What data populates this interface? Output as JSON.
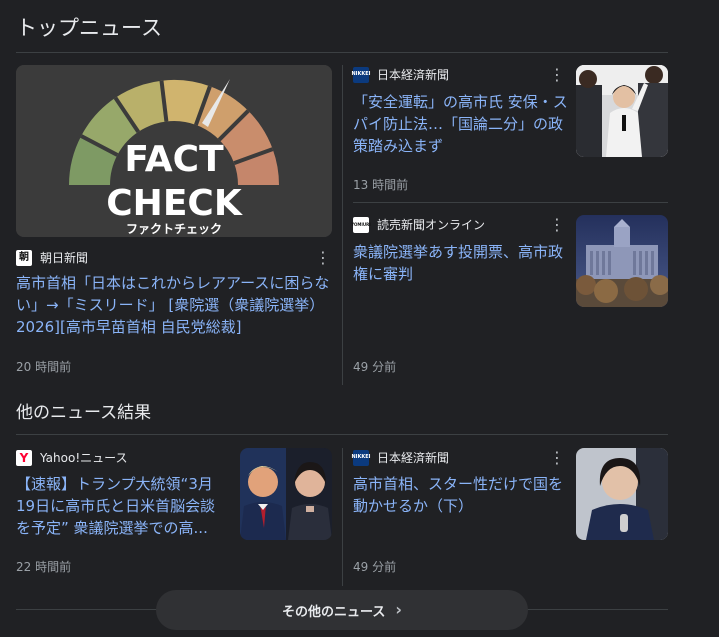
{
  "top_news": {
    "heading": "トップニュース",
    "featured": {
      "image_text_1": "FACT",
      "image_text_2": "CHECK",
      "image_text_3": "ファクトチェック",
      "source": "朝日新聞",
      "source_logo_text": "朝",
      "title": "高市首相「日本はこれからレアアースに困らない」→「ミスリード」 [衆院選（衆議院選挙）2026][高市早苗首相 自民党総裁]",
      "time": "20 時間前"
    },
    "right": [
      {
        "source": "日本経済新聞",
        "source_logo_text": "NIKKEI",
        "title": "「安全運転」の高市氏 安保・スパイ防止法…「国論二分」の政策踏み込まず",
        "time": "13 時間前"
      },
      {
        "source": "読売新聞オンライン",
        "source_logo_text": "YOMIURI",
        "title": "衆議院選挙あす投開票、高市政権に審判",
        "time": "49 分前"
      }
    ]
  },
  "other_news": {
    "heading": "他のニュース結果",
    "items": [
      {
        "source": "Yahoo!ニュース",
        "source_logo_text": "Y",
        "title": "【速報】トランプ大統領“3月19日に高市氏と日米首脳会談を予定” 衆議院選挙での高...",
        "time": "22 時間前"
      },
      {
        "source": "日本経済新聞",
        "source_logo_text": "NIKKEI",
        "title": "高市首相、スター性だけで国を動かせるか（下）",
        "time": "49 分前"
      }
    ],
    "more_button": "その他のニュース",
    "more_icon": "chevron-right-icon"
  }
}
